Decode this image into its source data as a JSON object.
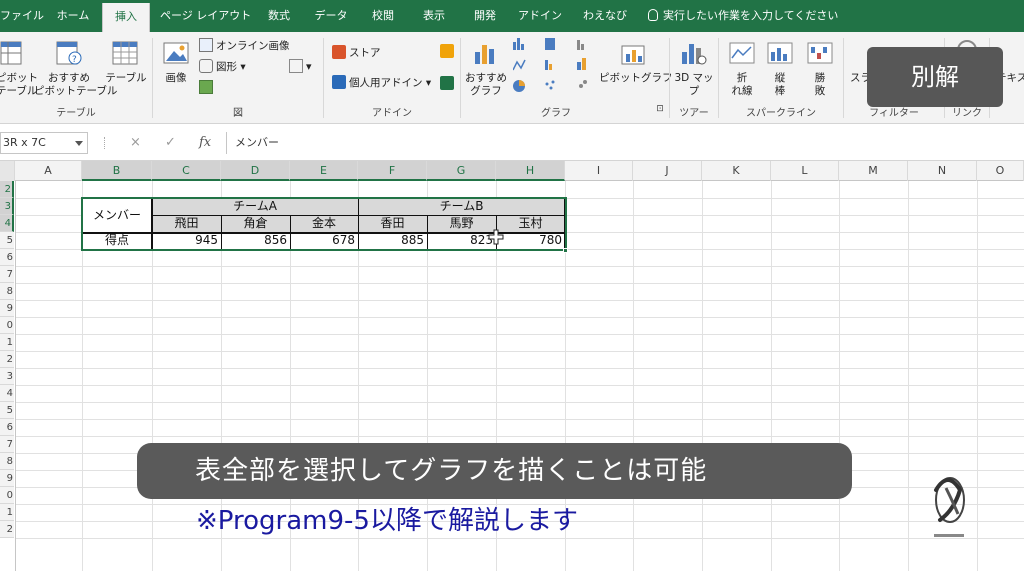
{
  "ribbon": {
    "tabs": [
      "ファイル",
      "ホーム",
      "挿入",
      "ページ レイアウト",
      "数式",
      "データ",
      "校閲",
      "表示",
      "開発",
      "アドイン",
      "わえなび"
    ],
    "active_tab": "挿入",
    "tell_me": "実行したい作業を入力してください",
    "groups": {
      "table": {
        "label": "テーブル",
        "pivot": "ピボット\nテーブル",
        "recommended_pivot": "おすすめ\nピボットテーブル",
        "table": "テーブル"
      },
      "illustrations": {
        "label": "図",
        "picture": "画像",
        "online_picture": "オンライン画像",
        "shapes": "図形"
      },
      "addins": {
        "label": "アドイン",
        "store": "ストア",
        "my_addins": "個人用アドイン"
      },
      "charts": {
        "label": "グラフ",
        "recommended": "おすすめ\nグラフ",
        "pivot_chart": "ピボットグラフ"
      },
      "tours": {
        "label": "ツアー",
        "map3d": "3D マッ\nプ"
      },
      "sparklines": {
        "label": "スパークライン",
        "line": "折\nれ線",
        "column": "縦\n棒",
        "winloss": "勝\n敗"
      },
      "filters": {
        "label": "フィルター",
        "slicer": "スライサー"
      },
      "links": {
        "label": "リンク"
      },
      "text": {
        "label": "テキス"
      }
    }
  },
  "formula_bar": {
    "name_box": "3R x 7C",
    "cancel": "×",
    "enter": "✓",
    "fx": "fx",
    "content": "メンバー"
  },
  "sheet": {
    "columns": [
      "A",
      "B",
      "C",
      "D",
      "E",
      "F",
      "G",
      "H",
      "I",
      "J",
      "K",
      "L",
      "M",
      "N",
      "O"
    ],
    "selected_columns": [
      "B",
      "C",
      "D",
      "E",
      "F",
      "G",
      "H"
    ],
    "rows": [
      "2",
      "3",
      "4",
      "5",
      "6",
      "7",
      "8",
      "9",
      "0",
      "1",
      "2",
      "3",
      "4",
      "5",
      "6",
      "7",
      "8",
      "9",
      "0",
      "1",
      "2"
    ],
    "selected_rows": [
      "2",
      "3",
      "4"
    ],
    "table": {
      "member_header": "メンバー",
      "team_a": "チームA",
      "team_b": "チームB",
      "names": [
        "飛田",
        "角倉",
        "金本",
        "香田",
        "馬野",
        "玉村"
      ],
      "score_label": "得点",
      "scores": [
        "945",
        "856",
        "678",
        "885",
        "823",
        "780"
      ]
    }
  },
  "overlay": {
    "badge": "別解",
    "caption": "表全部を選択してグラフを描くことは可能",
    "note": "※Program9-5以降で解説します"
  },
  "colors": {
    "excel_green": "#217346",
    "overlay_gray": "#5a5a5a",
    "note_blue": "#1a1aa0"
  }
}
